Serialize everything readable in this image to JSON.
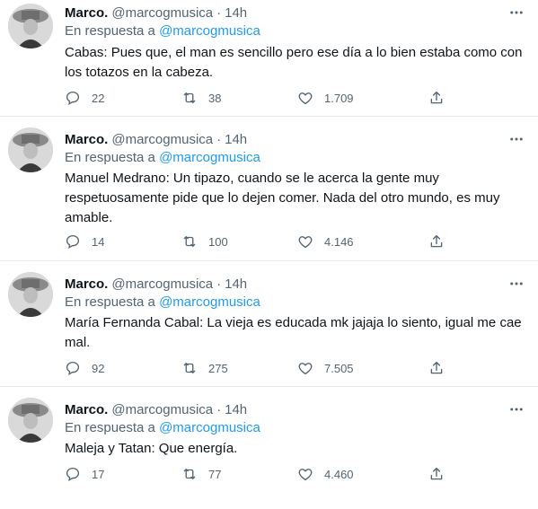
{
  "tweets": [
    {
      "name": "Marco.",
      "handle": "@marcogmusica",
      "separator": "·",
      "time": "14h",
      "reply_prefix": "En respuesta a",
      "reply_mention": "@marcogmusica",
      "text": "Cabas: Pues que, el man es sencillo pero ese día a lo bien estaba como con los totazos en la cabeza.",
      "replies": "22",
      "retweets": "38",
      "likes": "1.709"
    },
    {
      "name": "Marco.",
      "handle": "@marcogmusica",
      "separator": "·",
      "time": "14h",
      "reply_prefix": "En respuesta a",
      "reply_mention": "@marcogmusica",
      "text": "Manuel Medrano: Un tipazo, cuando se le acerca la gente muy respetuosamente pide que lo dejen comer. Nada del otro mundo, es muy amable.",
      "replies": "14",
      "retweets": "100",
      "likes": "4.146"
    },
    {
      "name": "Marco.",
      "handle": "@marcogmusica",
      "separator": "·",
      "time": "14h",
      "reply_prefix": "En respuesta a",
      "reply_mention": "@marcogmusica",
      "text": "María Fernanda Cabal: La vieja es educada mk jajaja lo siento, igual me cae mal.",
      "replies": "92",
      "retweets": "275",
      "likes": "7.505"
    },
    {
      "name": "Marco.",
      "handle": "@marcogmusica",
      "separator": "·",
      "time": "14h",
      "reply_prefix": "En respuesta a",
      "reply_mention": "@marcogmusica",
      "text": "Maleja y Tatan: Que energía.",
      "replies": "17",
      "retweets": "77",
      "likes": "4.460"
    }
  ],
  "icons": {
    "more": "more-icon",
    "reply": "reply-icon",
    "retweet": "retweet-icon",
    "like": "heart-icon",
    "share": "share-icon"
  },
  "colors": {
    "text": "#0f1419",
    "secondary": "#536471",
    "link": "#1d9bf0",
    "divider": "#e6ecf0"
  }
}
